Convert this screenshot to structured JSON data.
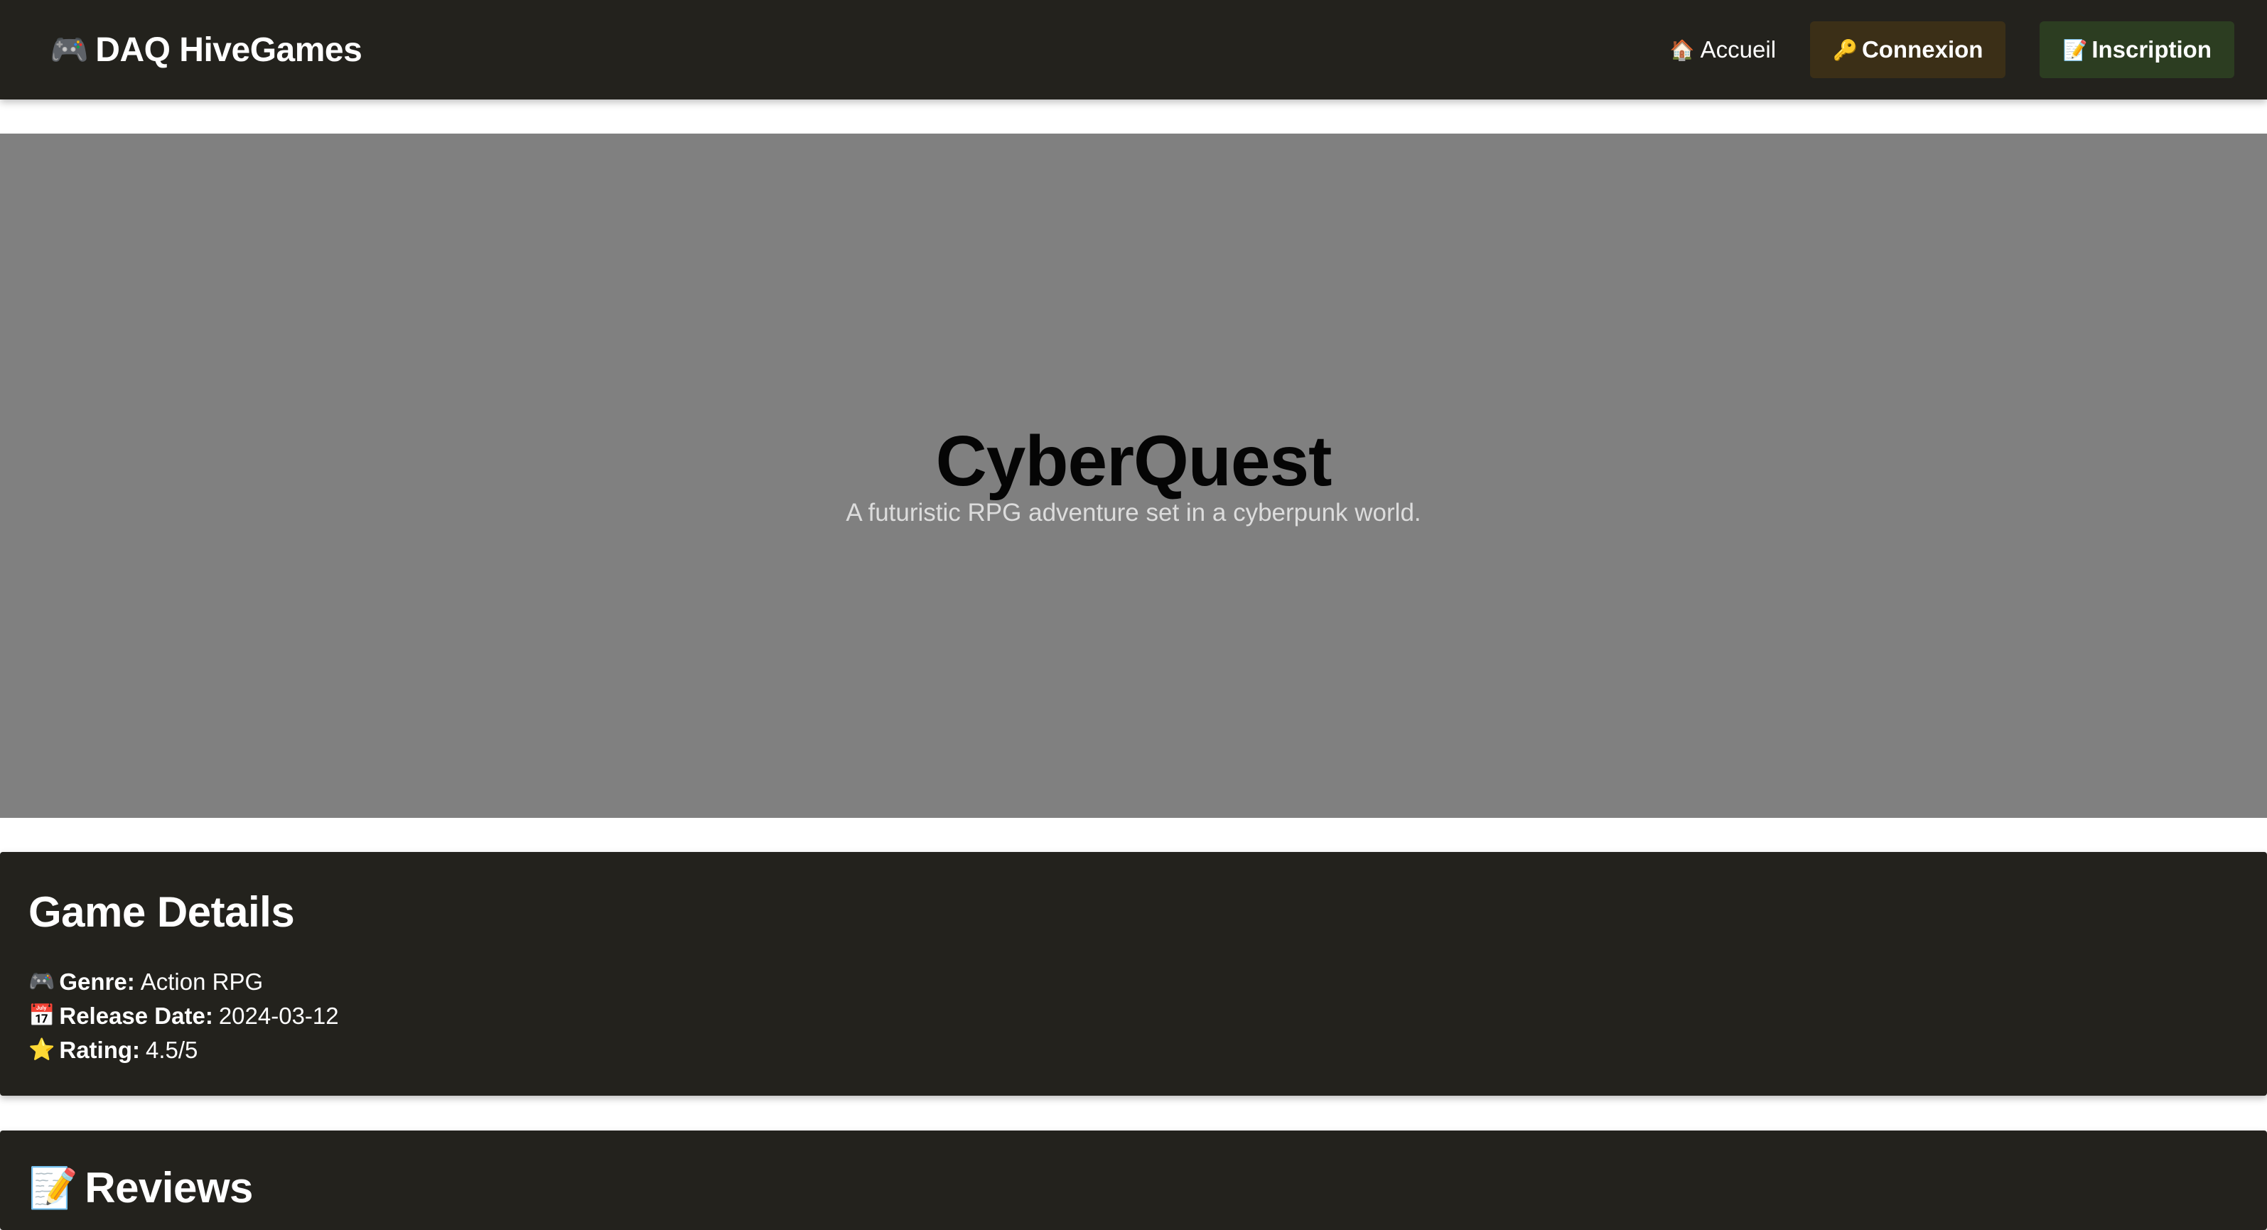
{
  "navbar": {
    "brand": {
      "icon": "🎮",
      "icon_name": "gamepad-icon",
      "text": "DAQ HiveGames"
    },
    "home_link": {
      "icon": "🏠",
      "icon_name": "house-icon",
      "label": "Accueil"
    },
    "login_button": {
      "icon": "🔑",
      "icon_name": "key-icon",
      "label": "Connexion",
      "color": "#3b2f17"
    },
    "signup_button": {
      "icon": "📝",
      "icon_name": "memo-icon",
      "label": "Inscription",
      "color": "#2c3d21"
    }
  },
  "hero": {
    "title": "CyberQuest",
    "subtitle": "A futuristic RPG adventure set in a cyberpunk world.",
    "background": "#808080"
  },
  "details": {
    "heading": "Game Details",
    "rows": [
      {
        "icon": "🎮",
        "icon_name": "gamepad-icon",
        "label": "Genre:",
        "value": "Action RPG"
      },
      {
        "icon": "📅",
        "icon_name": "calendar-icon",
        "label": "Release Date:",
        "value": "2024-03-12"
      },
      {
        "icon": "⭐",
        "icon_name": "star-icon",
        "label": "Rating:",
        "value": "4.5/5"
      }
    ]
  },
  "reviews": {
    "icon": "📝",
    "icon_name": "memo-icon",
    "heading": "Reviews"
  }
}
